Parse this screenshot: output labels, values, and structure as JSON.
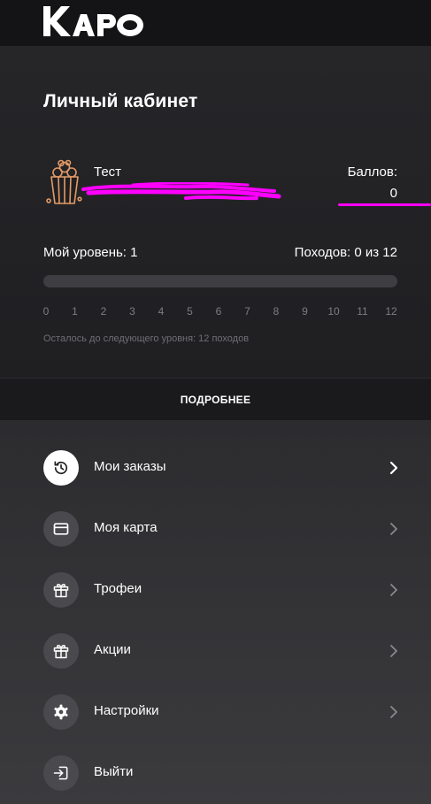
{
  "app": {
    "brand": "КАРО",
    "accent_color": "#ff00ff"
  },
  "profile": {
    "page_title": "Личный кабинет",
    "user_name": "Тест",
    "avatar_icon": "popcorn-icon",
    "points_label": "Баллов:",
    "points_value": "0"
  },
  "level": {
    "level_text": "Мой уровень: 1",
    "visits_text": "Походов: 0 из 12",
    "visits_done": 0,
    "visits_total": 12,
    "ticks": [
      "0",
      "1",
      "2",
      "3",
      "4",
      "5",
      "6",
      "7",
      "8",
      "9",
      "10",
      "11",
      "12"
    ],
    "remaining_text": "Осталось до следующего уровня: 12 походов"
  },
  "more_button": {
    "label": "ПОДРОБНЕЕ"
  },
  "menu": {
    "items": [
      {
        "label": "Мои заказы",
        "icon": "history-icon",
        "active": true
      },
      {
        "label": "Моя карта",
        "icon": "credit-card-icon",
        "active": false
      },
      {
        "label": "Трофеи",
        "icon": "gift-icon",
        "active": false
      },
      {
        "label": "Акции",
        "icon": "gift-icon",
        "active": false
      },
      {
        "label": "Настройки",
        "icon": "gear-icon",
        "active": false
      },
      {
        "label": "Выйти",
        "icon": "logout-icon",
        "active": false
      }
    ]
  }
}
